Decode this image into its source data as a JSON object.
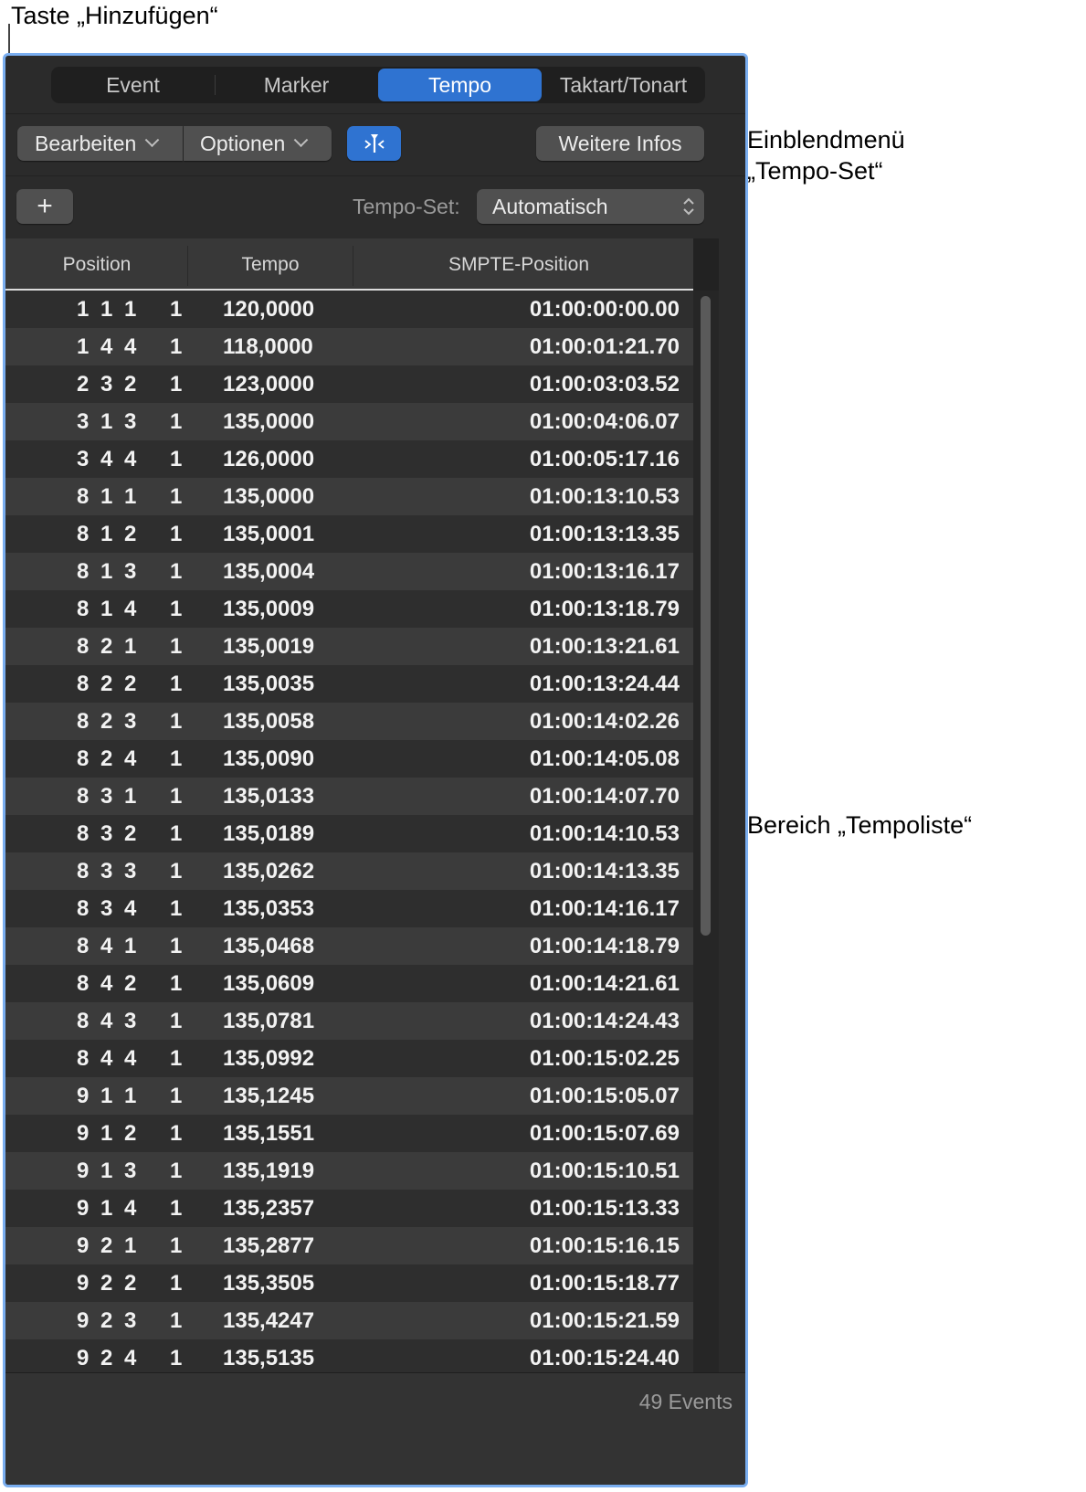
{
  "callouts": {
    "add_button": "Taste „Hinzufügen“",
    "tempo_set_line1": "Einblendmenü",
    "tempo_set_line2": "„Tempo-Set“",
    "tempo_list": "Bereich „Tempoliste“"
  },
  "tabs": [
    {
      "label": "Event",
      "active": false
    },
    {
      "label": "Marker",
      "active": false
    },
    {
      "label": "Tempo",
      "active": true
    },
    {
      "label": "Taktart/Tonart",
      "active": false
    }
  ],
  "toolbar": {
    "edit_label": "Bearbeiten",
    "options_label": "Optionen",
    "more_info_label": "Weitere Infos",
    "add_symbol": "+",
    "tempo_set_label": "Tempo-Set:",
    "tempo_set_value": "Automatisch"
  },
  "columns": [
    "Position",
    "Tempo",
    "SMPTE-Position"
  ],
  "rows": [
    {
      "bar": "1",
      "beat": "1",
      "div": "1",
      "tick": "1",
      "tempo": "120,0000",
      "smpte": "01:00:00:00.00"
    },
    {
      "bar": "1",
      "beat": "4",
      "div": "4",
      "tick": "1",
      "tempo": "118,0000",
      "smpte": "01:00:01:21.70"
    },
    {
      "bar": "2",
      "beat": "3",
      "div": "2",
      "tick": "1",
      "tempo": "123,0000",
      "smpte": "01:00:03:03.52"
    },
    {
      "bar": "3",
      "beat": "1",
      "div": "3",
      "tick": "1",
      "tempo": "135,0000",
      "smpte": "01:00:04:06.07"
    },
    {
      "bar": "3",
      "beat": "4",
      "div": "4",
      "tick": "1",
      "tempo": "126,0000",
      "smpte": "01:00:05:17.16"
    },
    {
      "bar": "8",
      "beat": "1",
      "div": "1",
      "tick": "1",
      "tempo": "135,0000",
      "smpte": "01:00:13:10.53"
    },
    {
      "bar": "8",
      "beat": "1",
      "div": "2",
      "tick": "1",
      "tempo": "135,0001",
      "smpte": "01:00:13:13.35"
    },
    {
      "bar": "8",
      "beat": "1",
      "div": "3",
      "tick": "1",
      "tempo": "135,0004",
      "smpte": "01:00:13:16.17"
    },
    {
      "bar": "8",
      "beat": "1",
      "div": "4",
      "tick": "1",
      "tempo": "135,0009",
      "smpte": "01:00:13:18.79"
    },
    {
      "bar": "8",
      "beat": "2",
      "div": "1",
      "tick": "1",
      "tempo": "135,0019",
      "smpte": "01:00:13:21.61"
    },
    {
      "bar": "8",
      "beat": "2",
      "div": "2",
      "tick": "1",
      "tempo": "135,0035",
      "smpte": "01:00:13:24.44"
    },
    {
      "bar": "8",
      "beat": "2",
      "div": "3",
      "tick": "1",
      "tempo": "135,0058",
      "smpte": "01:00:14:02.26"
    },
    {
      "bar": "8",
      "beat": "2",
      "div": "4",
      "tick": "1",
      "tempo": "135,0090",
      "smpte": "01:00:14:05.08"
    },
    {
      "bar": "8",
      "beat": "3",
      "div": "1",
      "tick": "1",
      "tempo": "135,0133",
      "smpte": "01:00:14:07.70"
    },
    {
      "bar": "8",
      "beat": "3",
      "div": "2",
      "tick": "1",
      "tempo": "135,0189",
      "smpte": "01:00:14:10.53"
    },
    {
      "bar": "8",
      "beat": "3",
      "div": "3",
      "tick": "1",
      "tempo": "135,0262",
      "smpte": "01:00:14:13.35"
    },
    {
      "bar": "8",
      "beat": "3",
      "div": "4",
      "tick": "1",
      "tempo": "135,0353",
      "smpte": "01:00:14:16.17"
    },
    {
      "bar": "8",
      "beat": "4",
      "div": "1",
      "tick": "1",
      "tempo": "135,0468",
      "smpte": "01:00:14:18.79"
    },
    {
      "bar": "8",
      "beat": "4",
      "div": "2",
      "tick": "1",
      "tempo": "135,0609",
      "smpte": "01:00:14:21.61"
    },
    {
      "bar": "8",
      "beat": "4",
      "div": "3",
      "tick": "1",
      "tempo": "135,0781",
      "smpte": "01:00:14:24.43"
    },
    {
      "bar": "8",
      "beat": "4",
      "div": "4",
      "tick": "1",
      "tempo": "135,0992",
      "smpte": "01:00:15:02.25"
    },
    {
      "bar": "9",
      "beat": "1",
      "div": "1",
      "tick": "1",
      "tempo": "135,1245",
      "smpte": "01:00:15:05.07"
    },
    {
      "bar": "9",
      "beat": "1",
      "div": "2",
      "tick": "1",
      "tempo": "135,1551",
      "smpte": "01:00:15:07.69"
    },
    {
      "bar": "9",
      "beat": "1",
      "div": "3",
      "tick": "1",
      "tempo": "135,1919",
      "smpte": "01:00:15:10.51"
    },
    {
      "bar": "9",
      "beat": "1",
      "div": "4",
      "tick": "1",
      "tempo": "135,2357",
      "smpte": "01:00:15:13.33"
    },
    {
      "bar": "9",
      "beat": "2",
      "div": "1",
      "tick": "1",
      "tempo": "135,2877",
      "smpte": "01:00:15:16.15"
    },
    {
      "bar": "9",
      "beat": "2",
      "div": "2",
      "tick": "1",
      "tempo": "135,3505",
      "smpte": "01:00:15:18.77"
    },
    {
      "bar": "9",
      "beat": "2",
      "div": "3",
      "tick": "1",
      "tempo": "135,4247",
      "smpte": "01:00:15:21.59"
    },
    {
      "bar": "9",
      "beat": "2",
      "div": "4",
      "tick": "1",
      "tempo": "135,5135",
      "smpte": "01:00:15:24.40"
    }
  ],
  "footer": {
    "event_count": "49 Events"
  },
  "colors": {
    "accent": "#2f73d1",
    "panel_border": "#7aaef0",
    "panel_bg": "#2b2b2b"
  }
}
